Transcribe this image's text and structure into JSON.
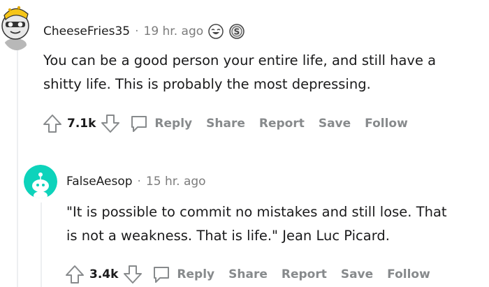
{
  "comments": [
    {
      "username": "CheeseFries35",
      "time": "19 hr. ago",
      "avatar_icon": "snoo-cheese-avatar-icon",
      "awards": [
        "laughing-face-award-icon",
        "silver-coin-award-icon"
      ],
      "body": [
        "You can be a good person your entire life, and still have a",
        "shitty life. This is probably the most depressing."
      ],
      "score": "7.1k",
      "actions": {
        "reply": "Reply",
        "share": "Share",
        "report": "Report",
        "save": "Save",
        "follow": "Follow"
      }
    },
    {
      "username": "FalseAesop",
      "time": "15 hr. ago",
      "avatar_icon": "default-snoo-avatar-icon",
      "body": [
        "\"It is possible to commit no mistakes and still lose. That",
        "is not a weakness. That is life.\" Jean Luc Picard."
      ],
      "score": "3.4k",
      "actions": {
        "reply": "Reply",
        "share": "Share",
        "report": "Report",
        "save": "Save",
        "follow": "Follow"
      }
    }
  ],
  "colors": {
    "accent_teal": "#0dd3bb",
    "meta_gray": "#7c7c7c",
    "action_gray": "#878a8c"
  }
}
